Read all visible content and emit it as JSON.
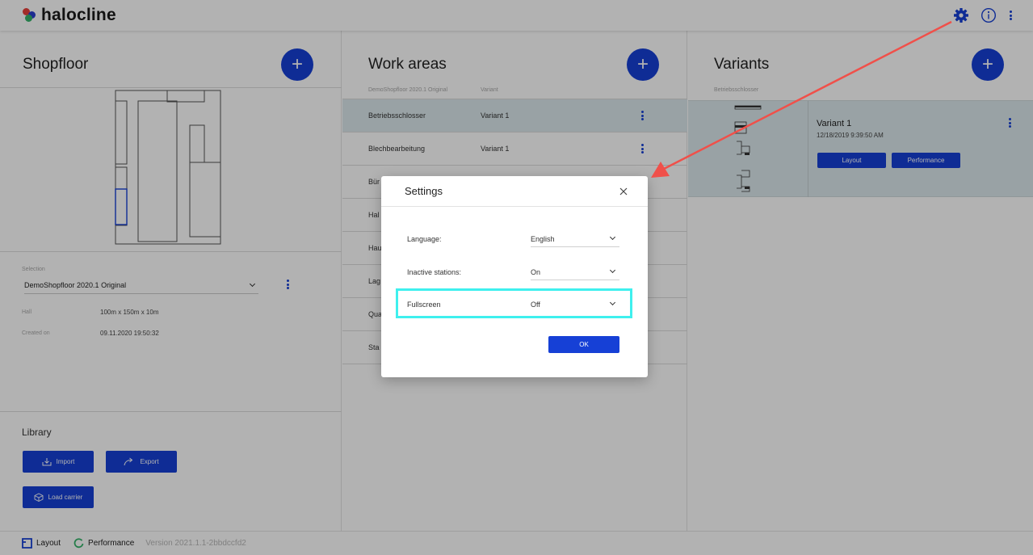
{
  "app": {
    "name": "halocline"
  },
  "shopfloor": {
    "title": "Shopfloor",
    "selection_label": "Selection",
    "selection_value": "DemoShopfloor 2020.1 Original",
    "hall_label": "Hall",
    "hall_value": "100m x 150m x 10m",
    "created_label": "Created on",
    "created_value": "09.11.2020 19:50:32"
  },
  "library": {
    "title": "Library",
    "import_label": "Import",
    "export_label": "Export",
    "load_carrier_label": "Load carrier"
  },
  "work_areas": {
    "title": "Work areas",
    "col1": "DemoShopfloor 2020.1 Original",
    "col2": "Variant",
    "rows": [
      {
        "name": "Betriebsschlosser",
        "variant": "Variant 1"
      },
      {
        "name": "Blechbearbeitung",
        "variant": "Variant 1"
      },
      {
        "name": "Bür",
        "variant": ""
      },
      {
        "name": "Hal",
        "variant": ""
      },
      {
        "name": "Hau",
        "variant": ""
      },
      {
        "name": "Lag",
        "variant": ""
      },
      {
        "name": "Qua",
        "variant": ""
      },
      {
        "name": "Sta",
        "variant": ""
      }
    ]
  },
  "variants": {
    "title": "Variants",
    "subhead": "Betriebsschlosser",
    "card": {
      "name": "Variant 1",
      "date": "12/18/2019 9:39:50 AM",
      "layout_label": "Layout",
      "performance_label": "Performance"
    }
  },
  "statusbar": {
    "layout_label": "Layout",
    "performance_label": "Performance",
    "version": "Version 2021.1.1-2bbdccfd2"
  },
  "settings_dialog": {
    "title": "Settings",
    "language_label": "Language:",
    "language_value": "English",
    "inactive_label": "Inactive stations:",
    "inactive_value": "On",
    "fullscreen_label": "Fullscreen",
    "fullscreen_value": "Off",
    "ok_label": "OK"
  },
  "colors": {
    "accent": "#1640d6",
    "highlight": "#3ff0ee",
    "annotation_arrow": "#f0504a",
    "selected_row": "#dce9ec"
  },
  "icons": {
    "settings": "gear-icon",
    "info": "info-icon",
    "more": "kebab-icon",
    "close": "close-icon"
  }
}
